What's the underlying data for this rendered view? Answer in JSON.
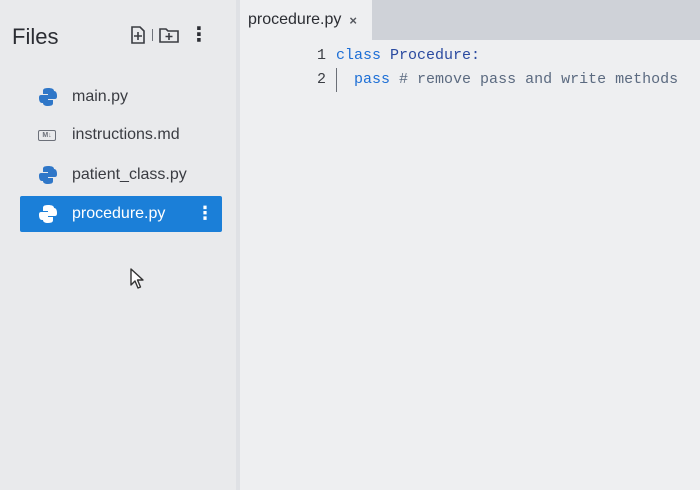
{
  "sidebar": {
    "title": "Files",
    "files": [
      {
        "name": "main.py",
        "icon": "python-icon"
      },
      {
        "name": "instructions.md",
        "icon": "markdown-icon"
      },
      {
        "name": "patient_class.py",
        "icon": "python-icon"
      },
      {
        "name": "procedure.py",
        "icon": "python-icon",
        "active": true
      }
    ],
    "md_badge": "M↓"
  },
  "editor": {
    "tab_label": "procedure.py",
    "tab_close": "×",
    "line_numbers": [
      "1",
      "2"
    ],
    "line1_keyword": "class",
    "line1_name": "Procedure:",
    "line2_keyword": "pass",
    "line2_comment": "# remove pass and write methods"
  },
  "colors": {
    "accent": "#1b7fd8",
    "python_icon": "#2f77c8"
  }
}
